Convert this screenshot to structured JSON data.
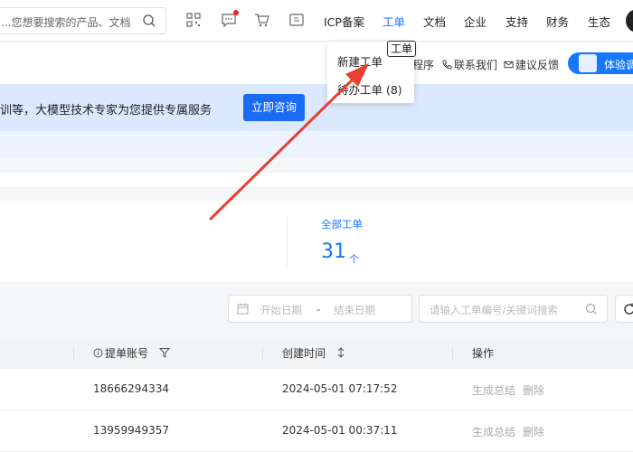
{
  "topnav": {
    "search_text": "...您想要搜索的产品、文档",
    "links": {
      "icp": "ICP备案",
      "ticket": "工单",
      "docs": "文档",
      "enterprise": "企业",
      "support": "支持",
      "finance": "财务",
      "ecosystem": "生态"
    },
    "icons": [
      "qrcode-icon",
      "message-icon",
      "cart-icon",
      "switch-icon"
    ]
  },
  "dropdown": {
    "new_ticket": "新建工单",
    "pending_ticket": "待办工单 (8)",
    "tooltip": "工单"
  },
  "subbar": {
    "mini_program": "程序",
    "contact": "联系我们",
    "feedback": "建议反馈",
    "experience": "体验调"
  },
  "banner": {
    "text": "训等，大模型技术专家为您提供专属服务",
    "consult_button": "立即咨询"
  },
  "stats": {
    "label": "全部工单",
    "count": "31",
    "unit": "个"
  },
  "filters": {
    "start_date": "开始日期",
    "separator": "-",
    "end_date": "结束日期",
    "search_placeholder": "请输入工单编号/关键词搜索"
  },
  "table": {
    "columns": {
      "account": "提单账号",
      "created": "创建时间",
      "actions": "操作"
    },
    "rows": [
      {
        "account": "18666294334",
        "created": "2024-05-01 07:17:52",
        "summary": "生成总结",
        "delete": "删除"
      },
      {
        "account": "13959949357",
        "created": "2024-05-01 00:37:11",
        "summary": "生成总结",
        "delete": "删除"
      }
    ]
  },
  "colors": {
    "accent": "#1677ff",
    "annotation_arrow": "#e8412f"
  }
}
